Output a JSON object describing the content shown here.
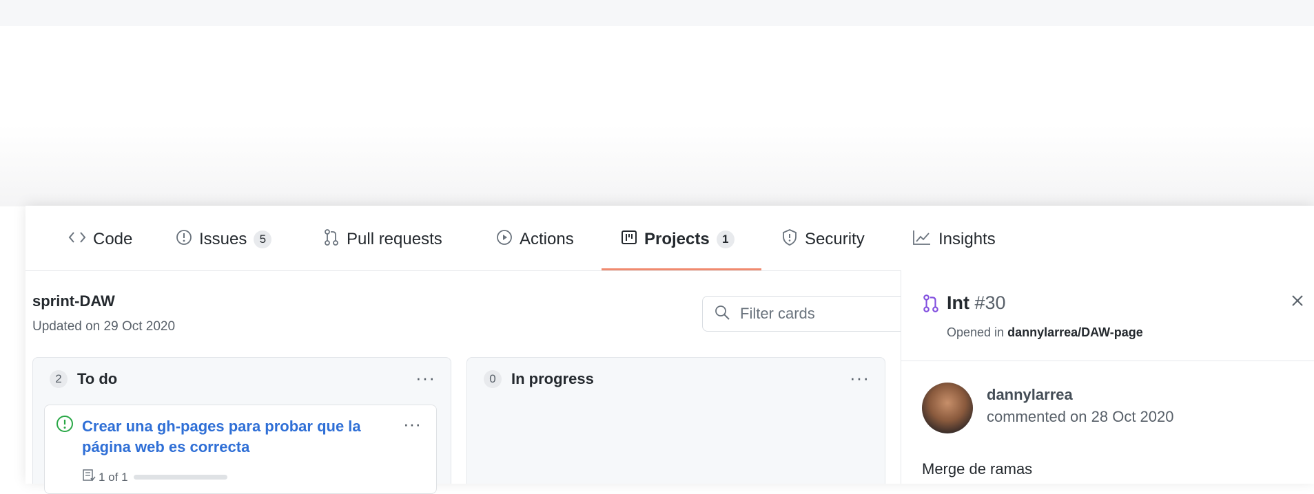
{
  "nav": {
    "tabs": [
      {
        "label": "Code",
        "icon": "code-icon"
      },
      {
        "label": "Issues",
        "icon": "issue-icon",
        "count": "5"
      },
      {
        "label": "Pull requests",
        "icon": "pull-request-icon"
      },
      {
        "label": "Actions",
        "icon": "play-icon"
      },
      {
        "label": "Projects",
        "icon": "project-icon",
        "count": "1",
        "active": true
      },
      {
        "label": "Security",
        "icon": "shield-icon"
      },
      {
        "label": "Insights",
        "icon": "graph-icon"
      }
    ]
  },
  "project": {
    "title": "sprint-DAW",
    "updated": "Updated on 29 Oct 2020",
    "filter_placeholder": "Filter cards"
  },
  "columns": [
    {
      "name": "To do",
      "count": "2",
      "cards": [
        {
          "title": "Crear una gh-pages para probar que la página web es correcta",
          "progress": "1 of 1",
          "progress_fraction": 1.0
        }
      ]
    },
    {
      "name": "In progress",
      "count": "0"
    }
  ],
  "panel": {
    "title": "Int",
    "number": "#30",
    "opened_prefix": "Opened in",
    "repo": "dannylarrea/DAW-page",
    "comment": {
      "author": "dannylarrea",
      "date": "commented on 28 Oct 2020",
      "body": "Merge de ramas"
    }
  },
  "colors": {
    "link": "#2f6fd6",
    "open_issue": "#28a745",
    "pr_icon": "#8250df",
    "active_underline": "#f08a6f"
  }
}
